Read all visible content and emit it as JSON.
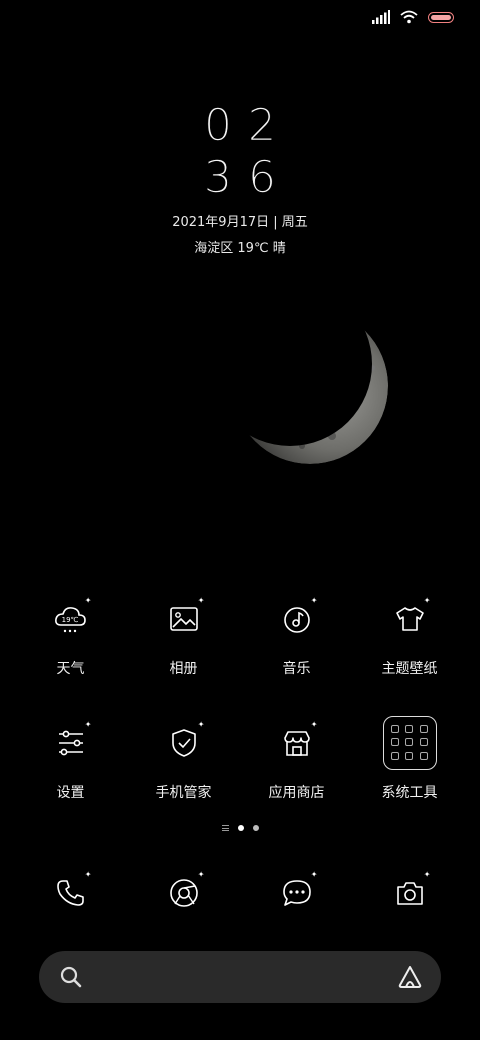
{
  "status": {
    "signal": "signal-icon",
    "wifi": "wifi-icon",
    "battery": "battery-icon"
  },
  "lockscreen": {
    "hour": "02",
    "minute": "36",
    "date": "2021年9月17日 | 周五",
    "weather": "海淀区 19℃ 晴"
  },
  "apps_row1": [
    {
      "label": "天气",
      "icon": "weather-icon",
      "badge": "19℃"
    },
    {
      "label": "相册",
      "icon": "gallery-icon"
    },
    {
      "label": "音乐",
      "icon": "music-icon"
    },
    {
      "label": "主题壁纸",
      "icon": "theme-icon"
    }
  ],
  "apps_row2": [
    {
      "label": "设置",
      "icon": "settings-icon"
    },
    {
      "label": "手机管家",
      "icon": "security-icon"
    },
    {
      "label": "应用商店",
      "icon": "store-icon"
    },
    {
      "label": "系统工具",
      "icon": "tools-folder-icon"
    }
  ],
  "pager": {
    "pages": 2,
    "active": 0
  },
  "dock": [
    {
      "icon": "phone-icon"
    },
    {
      "icon": "browser-icon"
    },
    {
      "icon": "messages-icon"
    },
    {
      "icon": "camera-icon"
    }
  ],
  "search": {
    "icon": "search-icon",
    "assistant": "assistant-icon"
  },
  "colors": {
    "background": "#000000",
    "text": "#ffffff",
    "search_bg": "#2a2a2a",
    "battery": "#f4a4a4"
  }
}
